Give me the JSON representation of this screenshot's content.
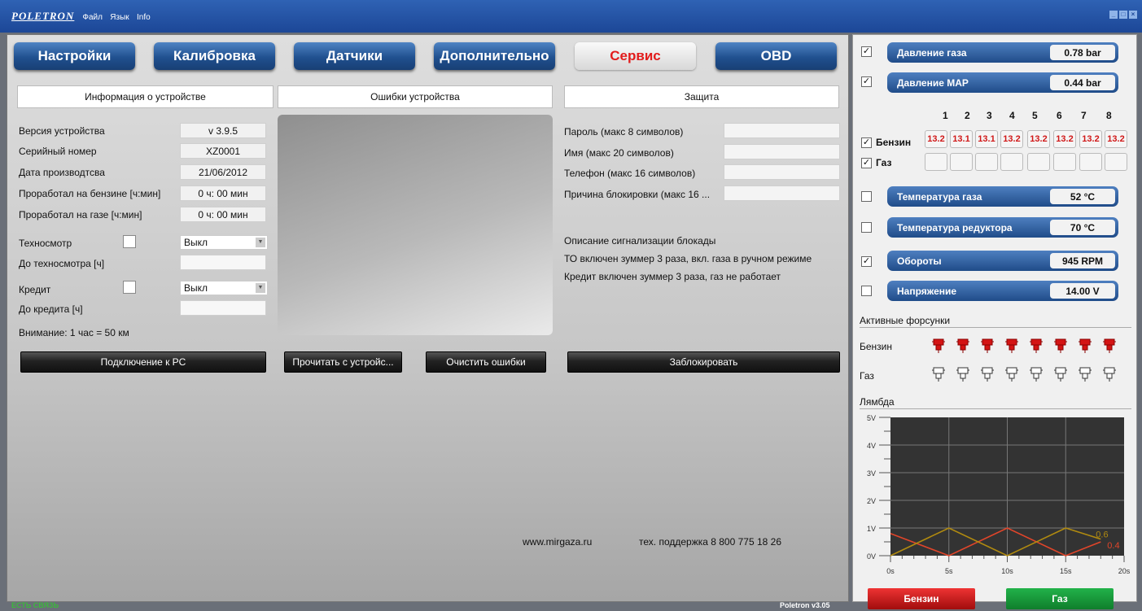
{
  "titlebar": {
    "logo": "POLETRON",
    "menu": [
      "Файл",
      "Язык",
      "Info"
    ]
  },
  "tabs": [
    {
      "label": "Настройки",
      "active": false
    },
    {
      "label": "Калибровка",
      "active": false
    },
    {
      "label": "Датчики",
      "active": false
    },
    {
      "label": "Дополнительно",
      "active": false
    },
    {
      "label": "Сервис",
      "active": true
    },
    {
      "label": "OBD",
      "active": false
    }
  ],
  "sections": {
    "info": "Информация о устройстве",
    "errors": "Ошибки устройства",
    "protection": "Защита"
  },
  "info": {
    "version_label": "Версия устройства",
    "version": "v 3.9.5",
    "serial_label": "Серийный номер",
    "serial": "XZ0001",
    "date_label": "Дата производтсва",
    "date": "21/06/2012",
    "petrol_label": "Проработал на бензине [ч:мин]",
    "petrol": "0 ч: 00 мин",
    "gas_label": "Проработал на газе [ч:мин]",
    "gas": "0 ч: 00 мин",
    "inspection_label": "Техносмотр",
    "inspection_select": "Выкл",
    "to_inspection_label": "До техносмотра [ч]",
    "credit_label": "Кредит",
    "credit_select": "Выкл",
    "to_credit_label": "До кредита [ч]",
    "note": "Внимание: 1 час = 50 км"
  },
  "protection": {
    "password_label": "Пароль (макс 8 символов)",
    "name_label": "Имя (макс 20 символов)",
    "phone_label": "Телефон (макс 16 символов)",
    "reason_label": "Причина блокировки (макс 16 ...",
    "desc_title": "Описание сигнализации блокады",
    "desc_line1": "ТО включен зуммер 3 раза, вкл. газа в ручном режиме",
    "desc_line2": "Кредит включен зуммер 3 раза, газ не работает"
  },
  "buttons": {
    "connect": "Подключение к PC",
    "read": "Прочитать с устройс...",
    "clear": "Очистить ошибки",
    "lock": "Заблокировать"
  },
  "contacts": {
    "site": "www.mirgaza.ru",
    "support": "тех. поддержка  8 800 775 18 26"
  },
  "status": {
    "connection": "ЕСТЬ СВЯЗЬ",
    "version": "Poletron v3.05"
  },
  "right": {
    "gas_pressure": {
      "label": "Давление газа",
      "value": "0.78 bar",
      "checked": true
    },
    "map_pressure": {
      "label": "Давление MAP",
      "value": "0.44 bar",
      "checked": true
    },
    "cylinders": [
      "1",
      "2",
      "3",
      "4",
      "5",
      "6",
      "7",
      "8"
    ],
    "petrol_label": "Бензин",
    "gas_label": "Газ",
    "petrol_values": [
      "13.2",
      "13.1",
      "13.1",
      "13.2",
      "13.2",
      "13.2",
      "13.2",
      "13.2"
    ],
    "gas_temp": {
      "label": "Температура газа",
      "value": "52 °C",
      "checked": false
    },
    "reducer_temp": {
      "label": "Температура редуктора",
      "value": "70 °C",
      "checked": false
    },
    "rpm": {
      "label": "Обороты",
      "value": "945 RPM",
      "checked": true
    },
    "voltage": {
      "label": "Напряжение",
      "value": "14.00 V",
      "checked": false
    },
    "injectors_title": "Активные форсунки",
    "inj_petrol": "Бензин",
    "inj_gas": "Газ",
    "lambda_title": "Лямбда",
    "btn_petrol": "Бензин",
    "btn_gas": "Газ"
  },
  "chart_data": {
    "type": "line",
    "title": "Лямбда",
    "ylim": [
      0,
      5
    ],
    "xlim": [
      0,
      20
    ],
    "yticks": [
      "5V",
      "4V",
      "3V",
      "2V",
      "1V",
      "0V"
    ],
    "xticks": [
      "0s",
      "5s",
      "10s",
      "15s",
      "20s"
    ],
    "series": [
      {
        "name": "",
        "color": "#e0452a",
        "x": [
          0,
          5,
          10,
          15,
          18
        ],
        "y": [
          0.8,
          0,
          1,
          0,
          0.5
        ],
        "end_label": "0.4"
      },
      {
        "name": "",
        "color": "#b08a10",
        "x": [
          0,
          5,
          10,
          15,
          18
        ],
        "y": [
          0,
          1,
          0,
          1,
          0.6
        ],
        "end_label": "0.6"
      }
    ]
  }
}
